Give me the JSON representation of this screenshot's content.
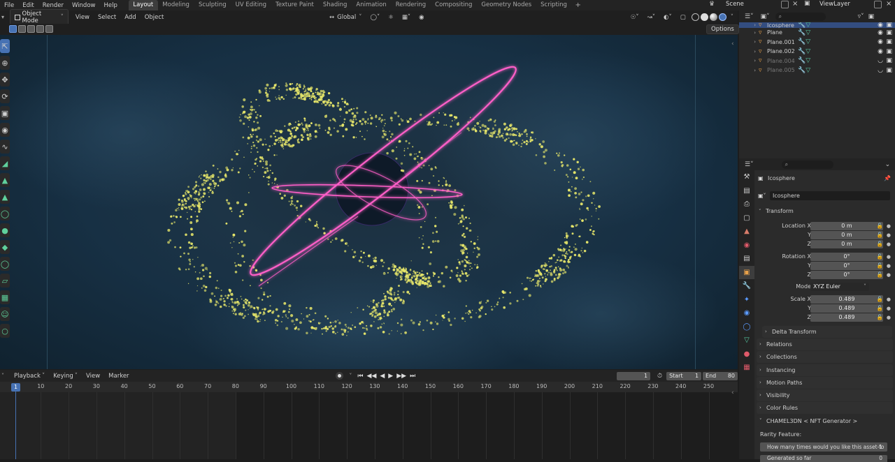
{
  "topbar": {
    "menus": [
      "File",
      "Edit",
      "Render",
      "Window",
      "Help"
    ],
    "workspaces": [
      "Layout",
      "Modeling",
      "Sculpting",
      "UV Editing",
      "Texture Paint",
      "Shading",
      "Animation",
      "Rendering",
      "Compositing",
      "Geometry Nodes",
      "Scripting"
    ],
    "active_workspace": "Layout",
    "add_tab": "+",
    "scene": "Scene",
    "view_layer": "ViewLayer"
  },
  "viewport_header": {
    "mode": "Object Mode",
    "menus": [
      "View",
      "Select",
      "Add",
      "Object"
    ],
    "transform_orientation": "Global",
    "options": "Options"
  },
  "outliner": {
    "items": [
      {
        "name": "Icosphere",
        "selected": true,
        "dim": false
      },
      {
        "name": "Plane",
        "selected": false,
        "dim": false
      },
      {
        "name": "Plane.001",
        "selected": false,
        "dim": false
      },
      {
        "name": "Plane.002",
        "selected": false,
        "dim": false
      },
      {
        "name": "Plane.004",
        "selected": false,
        "dim": true
      },
      {
        "name": "Plane.005",
        "selected": false,
        "dim": true
      }
    ]
  },
  "properties": {
    "object_name": "Icosphere",
    "object_datablock": "Icosphere",
    "transform_panel": "Transform",
    "location_label": "Location X",
    "location": [
      "0 m",
      "0 m",
      "0 m"
    ],
    "rotation_label": "Rotation X",
    "rotation": [
      "0°",
      "0°",
      "0°"
    ],
    "mode_label": "Mode",
    "mode_value": "XYZ Euler",
    "scale_label": "Scale X",
    "scale": [
      "0.489",
      "0.489",
      "0.489"
    ],
    "y_label": "Y",
    "z_label": "Z",
    "delta_transform": "Delta Transform",
    "panels": [
      "Relations",
      "Collections",
      "Instancing",
      "Motion Paths",
      "Visibility",
      "Color Rules"
    ],
    "addon_panel": "CHAMEL3DN < NFT Generator >",
    "rarity_label": "Rarity Feature:",
    "rarity_question": "How many times would you like this asset to",
    "rarity_value": "-1",
    "generated_label": "Generated so far",
    "generated_value": "0"
  },
  "timeline": {
    "menus": [
      "Playback",
      "Keying",
      "View",
      "Marker"
    ],
    "current_frame": "1",
    "start_label": "Start",
    "start": "1",
    "end_label": "End",
    "end": "80",
    "ruler": [
      "10",
      "20",
      "30",
      "40",
      "50",
      "60",
      "70",
      "80",
      "90",
      "100",
      "110",
      "120",
      "130",
      "140",
      "150",
      "160",
      "170",
      "180",
      "190",
      "200",
      "210",
      "220",
      "230",
      "240",
      "250"
    ],
    "frame_indicator": "1"
  },
  "colors": {
    "accent": "#4772b3",
    "particles": "#e6e66a",
    "rings": "#ff5fc8"
  }
}
